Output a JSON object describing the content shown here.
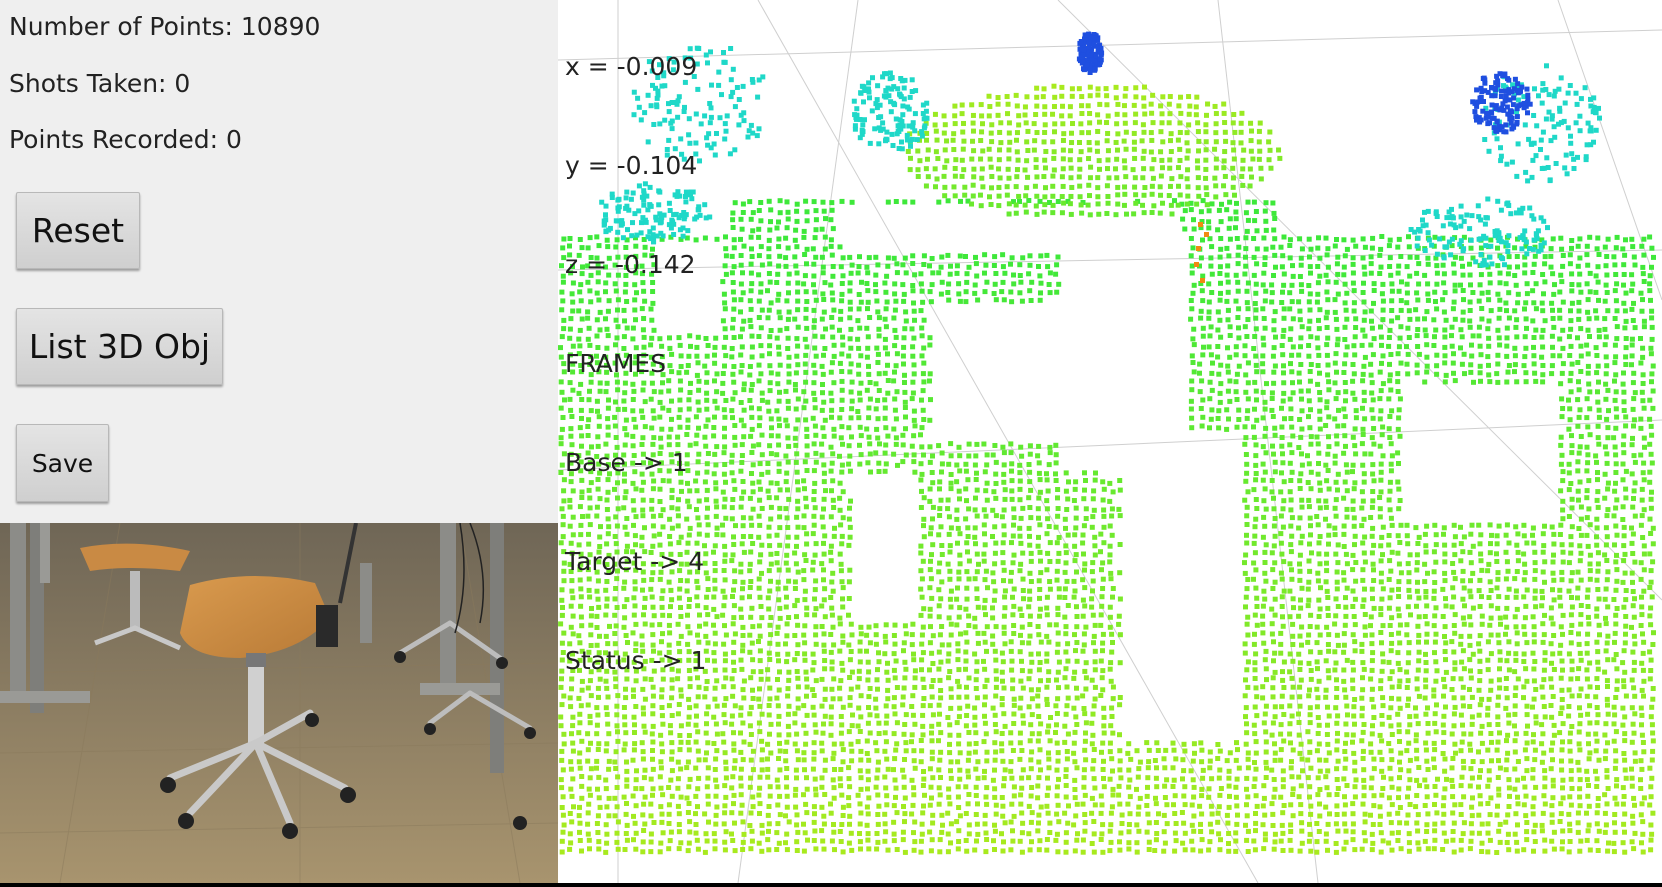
{
  "stats": {
    "num_points": "Number of Points: 10890",
    "shots_taken": "Shots Taken: 0",
    "points_recorded": "Points Recorded: 0"
  },
  "buttons": {
    "reset": "Reset",
    "list_3d_obj": "List 3D Obj",
    "save": "Save"
  },
  "overlay": {
    "x_line": "x = -0.009",
    "y_line": "y = -0.104",
    "z_line": "z = -0.142",
    "frames_header": "FRAMES",
    "base": "Base -> 1",
    "target": "Target -> 4",
    "status": "Status -> 1"
  },
  "colors": {
    "panel_bg": "#efefef",
    "viewer_bg": "#ffffff",
    "point_green": "#3ee83a",
    "point_lime": "#a8ea1e",
    "point_cyan": "#1fd8c8",
    "point_blue": "#1f4fe0",
    "point_orange": "#f08a10"
  },
  "icons": {
    "camera_preview": "camera-feed-chair-scene"
  }
}
